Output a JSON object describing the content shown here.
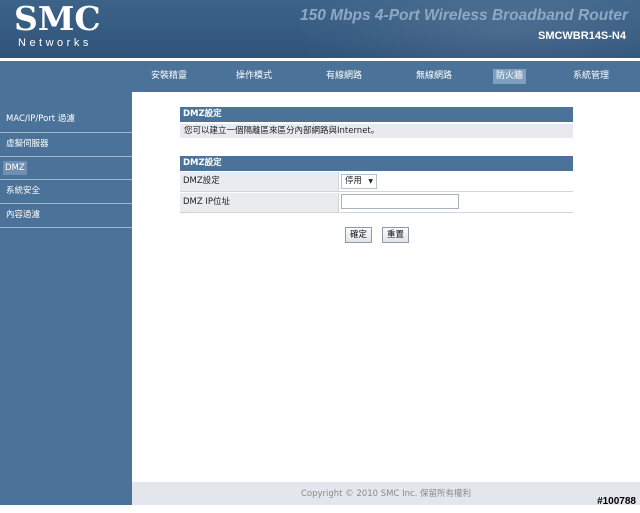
{
  "header": {
    "logo_main": "SMC",
    "logo_sub": "Networks",
    "product_title": "150 Mbps 4-Port Wireless Broadband Router",
    "model": "SMCWBR14S-N4"
  },
  "nav": {
    "items": [
      "安裝精靈",
      "操作模式",
      "有線網路",
      "無線網路",
      "防火牆",
      "系統管理"
    ],
    "active": "防火牆"
  },
  "sidebar": {
    "items": [
      "MAC/IP/Port 過濾",
      "虛擬伺服器",
      "DMZ",
      "系統安全",
      "內容過濾"
    ],
    "active": "DMZ"
  },
  "section1": {
    "title": "DMZ設定",
    "description": "您可以建立一個隔離區來區分內部網路與Internet。"
  },
  "section2": {
    "title": "DMZ設定",
    "dmz_setting_label": "DMZ設定",
    "dmz_setting_value": "停用",
    "dmz_ip_label": "DMZ IP位址",
    "dmz_ip_value": ""
  },
  "buttons": {
    "apply": "確定",
    "reset": "重置"
  },
  "footer": {
    "copyright": "Copyright © 2010 SMC Inc. 保留所有權利"
  },
  "image_id": "#100788",
  "colors": {
    "header_bg": "#355a80",
    "nav_bg": "#4b7298",
    "section_bar": "#4b7298",
    "active_tab": "#7f9fbe"
  }
}
